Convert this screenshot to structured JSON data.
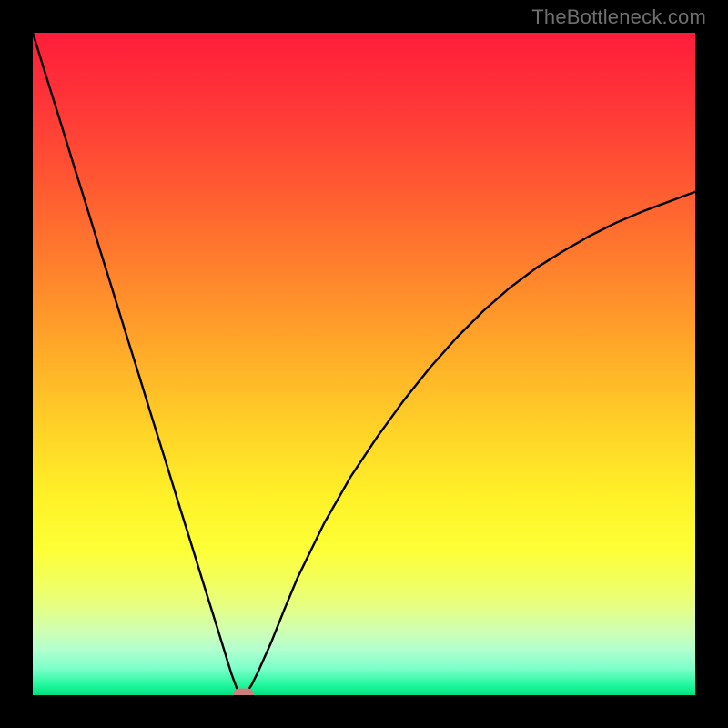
{
  "attribution": "TheBottleneck.com",
  "chart_data": {
    "type": "line",
    "title": "",
    "xlabel": "",
    "ylabel": "",
    "xlim": [
      0,
      100
    ],
    "ylim": [
      0,
      100
    ],
    "grid": false,
    "legend": false,
    "background": "heatmap-gradient-rainbow",
    "series": [
      {
        "name": "bottleneck-curve",
        "color": "#000000",
        "x": [
          0,
          2,
          4,
          6,
          8,
          10,
          12,
          14,
          16,
          18,
          20,
          22,
          24,
          26,
          28,
          30,
          31,
          32,
          33,
          34,
          36,
          38,
          40,
          44,
          48,
          52,
          56,
          60,
          64,
          68,
          72,
          76,
          80,
          84,
          88,
          92,
          96,
          100
        ],
        "y": [
          100,
          93.5,
          87.1,
          80.6,
          74.2,
          67.7,
          61.3,
          54.8,
          48.4,
          41.9,
          35.5,
          29.0,
          22.6,
          16.1,
          9.7,
          3.2,
          0.5,
          0.0,
          1.5,
          3.5,
          8.0,
          13.0,
          17.8,
          26.0,
          33.0,
          39.0,
          44.5,
          49.5,
          54.0,
          58.0,
          61.5,
          64.5,
          67.0,
          69.3,
          71.3,
          73.0,
          74.5,
          76.0
        ]
      }
    ],
    "marker": {
      "name": "optimal-point",
      "x": 31.8,
      "y": 0.0,
      "color": "#cf7f7b",
      "shape": "rounded-pill"
    },
    "gradient_stops": [
      {
        "pos": 0.0,
        "color": "#ff1d3a"
      },
      {
        "pos": 0.1,
        "color": "#ff3438"
      },
      {
        "pos": 0.2,
        "color": "#ff5033"
      },
      {
        "pos": 0.3,
        "color": "#ff6f2e"
      },
      {
        "pos": 0.4,
        "color": "#ff8f2b"
      },
      {
        "pos": 0.5,
        "color": "#ffb128"
      },
      {
        "pos": 0.6,
        "color": "#ffd327"
      },
      {
        "pos": 0.7,
        "color": "#fff128"
      },
      {
        "pos": 0.78,
        "color": "#fdff36"
      },
      {
        "pos": 0.82,
        "color": "#f4ff56"
      },
      {
        "pos": 0.86,
        "color": "#e8ff7c"
      },
      {
        "pos": 0.9,
        "color": "#d1ffae"
      },
      {
        "pos": 0.93,
        "color": "#b3ffcf"
      },
      {
        "pos": 0.96,
        "color": "#7cffca"
      },
      {
        "pos": 0.985,
        "color": "#1ff79d"
      },
      {
        "pos": 1.0,
        "color": "#00e07f"
      }
    ]
  }
}
